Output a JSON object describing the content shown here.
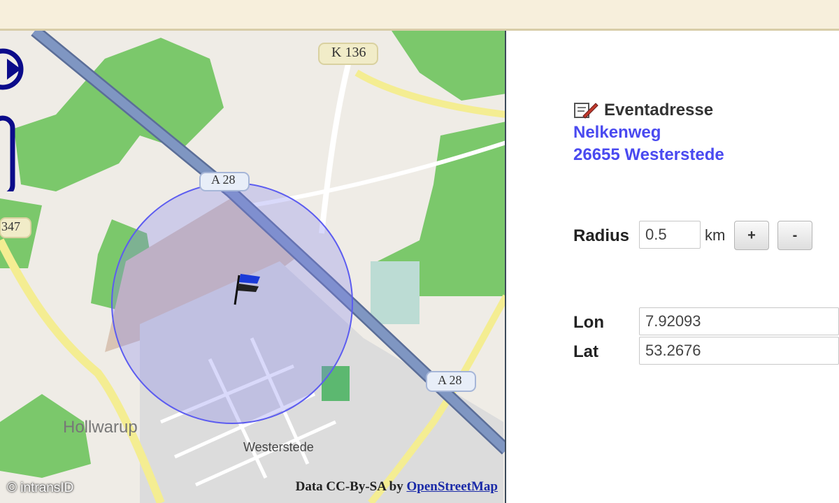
{
  "map": {
    "road_labels": [
      "K 136",
      "A 28",
      "A 28",
      "347"
    ],
    "place_labels": [
      "Hollwarup",
      "Westerstede"
    ],
    "attribution_prefix": "Data CC-By-SA by",
    "attribution_link": "OpenStreetMap",
    "copyright": "© intransID",
    "colors": {
      "forest": "#7bc86b",
      "radius": "#8080ee",
      "motorway": "#7f96c2",
      "road": "#f4ed92"
    }
  },
  "panel": {
    "event_title": "Eventadresse",
    "street": "Nelkenweg",
    "city": "26655 Westerstede",
    "radius_label": "Radius",
    "radius_value": "0.5",
    "radius_unit": "km",
    "plus_label": "+",
    "minus_label": "-",
    "lon_label": "Lon",
    "lon_value": "7.92093",
    "lat_label": "Lat",
    "lat_value": "53.2676"
  }
}
